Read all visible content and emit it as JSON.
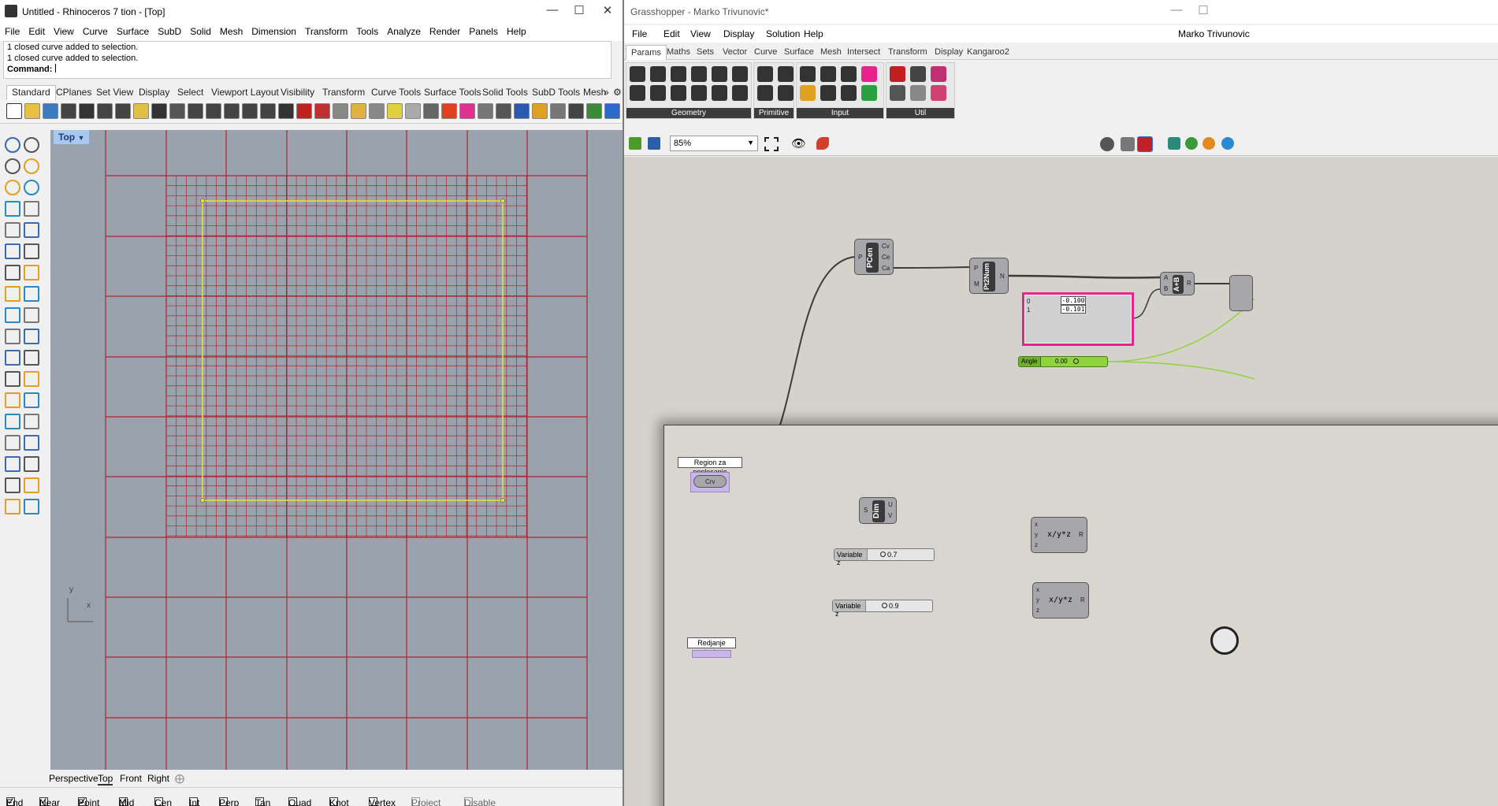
{
  "rhino": {
    "title": "Untitled - Rhinoceros 7 tion - [Top]",
    "menu": [
      "File",
      "Edit",
      "View",
      "Curve",
      "Surface",
      "SubD",
      "Solid",
      "Mesh",
      "Dimension",
      "Transform",
      "Tools",
      "Analyze",
      "Render",
      "Panels",
      "Help"
    ],
    "history": [
      "1 closed curve added to selection.",
      "1 closed curve added to selection."
    ],
    "command_label": "Command:",
    "toolbar_tabs": [
      "Standard",
      "CPlanes",
      "Set View",
      "Display",
      "Select",
      "Viewport Layout",
      "Visibility",
      "Transform",
      "Curve Tools",
      "Surface Tools",
      "Solid Tools",
      "SubD Tools",
      "Mesh"
    ],
    "viewport_name": "Top",
    "axis_y": "y",
    "axis_x": "x",
    "viewport_tabs": [
      "Perspective",
      "Top",
      "Front",
      "Right"
    ],
    "osnaps": [
      {
        "label": "End",
        "checked": true
      },
      {
        "label": "Near",
        "checked": true
      },
      {
        "label": "Point",
        "checked": true
      },
      {
        "label": "Mid",
        "checked": true
      },
      {
        "label": "Cen",
        "checked": false
      },
      {
        "label": "Int",
        "checked": false
      },
      {
        "label": "Perp",
        "checked": false
      },
      {
        "label": "Tan",
        "checked": false
      },
      {
        "label": "Quad",
        "checked": false
      },
      {
        "label": "Knot",
        "checked": false
      },
      {
        "label": "Vertex",
        "checked": false
      },
      {
        "label": "Project",
        "checked": false
      },
      {
        "label": "Disable",
        "checked": false
      }
    ],
    "colors": {
      "viewport_bg": "#9aa3ad",
      "grid_line": "#b0242c",
      "selection": "#f0e03c",
      "viewport_label": "#a9c8ef"
    }
  },
  "gh": {
    "title": "Grasshopper - Marko Trivunovic*",
    "menu": [
      "File",
      "Edit",
      "View",
      "Display",
      "Solution",
      "Help"
    ],
    "user": "Marko Trivunovic",
    "tabs": [
      "Params",
      "Maths",
      "Sets",
      "Vector",
      "Curve",
      "Surface",
      "Mesh",
      "Intersect",
      "Transform",
      "Display",
      "Kangaroo2"
    ],
    "groups": [
      "Geometry",
      "Primitive",
      "Input",
      "Util"
    ],
    "zoom": "85%",
    "components": {
      "pcen": {
        "name": "PCen",
        "inputs": [
          "P"
        ],
        "outputs": [
          "Cv",
          "Ce",
          "Ca"
        ]
      },
      "pt2num": {
        "name": "Pt2Num",
        "inputs": [
          "P",
          "M"
        ],
        "outputs": [
          "N"
        ]
      },
      "addition": {
        "name": "A+B",
        "inputs": [
          "A",
          "B"
        ],
        "outputs": [
          "R"
        ]
      },
      "dim": {
        "name": "Dim",
        "inputs": [
          "S"
        ],
        "outputs": [
          "U",
          "V"
        ]
      },
      "expr1": {
        "name": "x/y*z",
        "inputs": [
          "x",
          "y",
          "z"
        ],
        "outputs": [
          "R"
        ]
      },
      "expr2": {
        "name": "x/y*z",
        "inputs": [
          "x",
          "y",
          "z"
        ],
        "outputs": [
          "R"
        ]
      }
    },
    "panel": {
      "rows": [
        {
          "index": "0",
          "value": "-0.100"
        },
        {
          "index": "1",
          "value": "-0.101"
        }
      ]
    },
    "angle_slider": {
      "label": "Angle",
      "value": "0.00",
      "fraction": 0.3
    },
    "slider_z1": {
      "label": "Variable z",
      "value": "0.7",
      "fraction": 0.7
    },
    "slider_z2": {
      "label": "Variable z",
      "value": "0.9",
      "fraction": 0.9
    },
    "param_region": {
      "label": "Region za poplocanje",
      "pin": "Crv"
    },
    "param_bottom": {
      "label": "Redjanje plocica"
    },
    "colors": {
      "canvas": "#d4d2ca",
      "panel_border": "#e8248c",
      "slider_green": "#8fd43c",
      "wire": "#3b3b3b",
      "wire_green": "#8fd43c",
      "param_purple": "#c9b6e8"
    }
  }
}
